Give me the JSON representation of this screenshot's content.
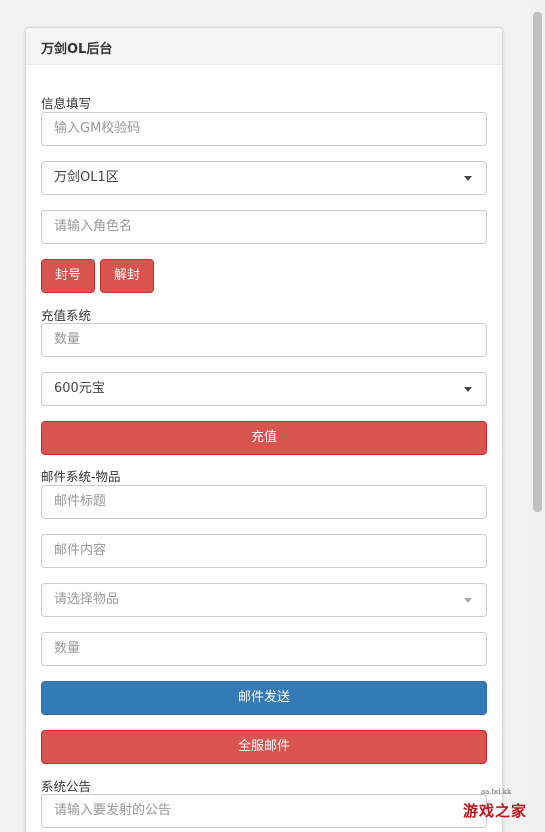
{
  "header": {
    "title": "万剑OL后台"
  },
  "info": {
    "label": "信息填写",
    "gm_code_placeholder": "输入GM校验码",
    "server_selected": "万剑OL1区",
    "role_placeholder": "请输入角色名",
    "ban_label": "封号",
    "unban_label": "解封"
  },
  "recharge": {
    "label": "充值系统",
    "amount_placeholder": "数量",
    "currency_selected": "600元宝",
    "submit_label": "充值"
  },
  "mail": {
    "label": "邮件系统-物品",
    "title_placeholder": "邮件标题",
    "content_placeholder": "邮件内容",
    "item_placeholder": "请选择物品",
    "quantity_placeholder": "数量",
    "send_label": "邮件发送",
    "all_server_label": "全服邮件"
  },
  "announcement": {
    "label": "系统公告",
    "input_placeholder": "请输入要发射的公告"
  },
  "watermark": {
    "main": "游戏之家",
    "sub": "aa.bd.kk"
  },
  "colors": {
    "danger": "#d9534f",
    "primary": "#337ab7"
  }
}
